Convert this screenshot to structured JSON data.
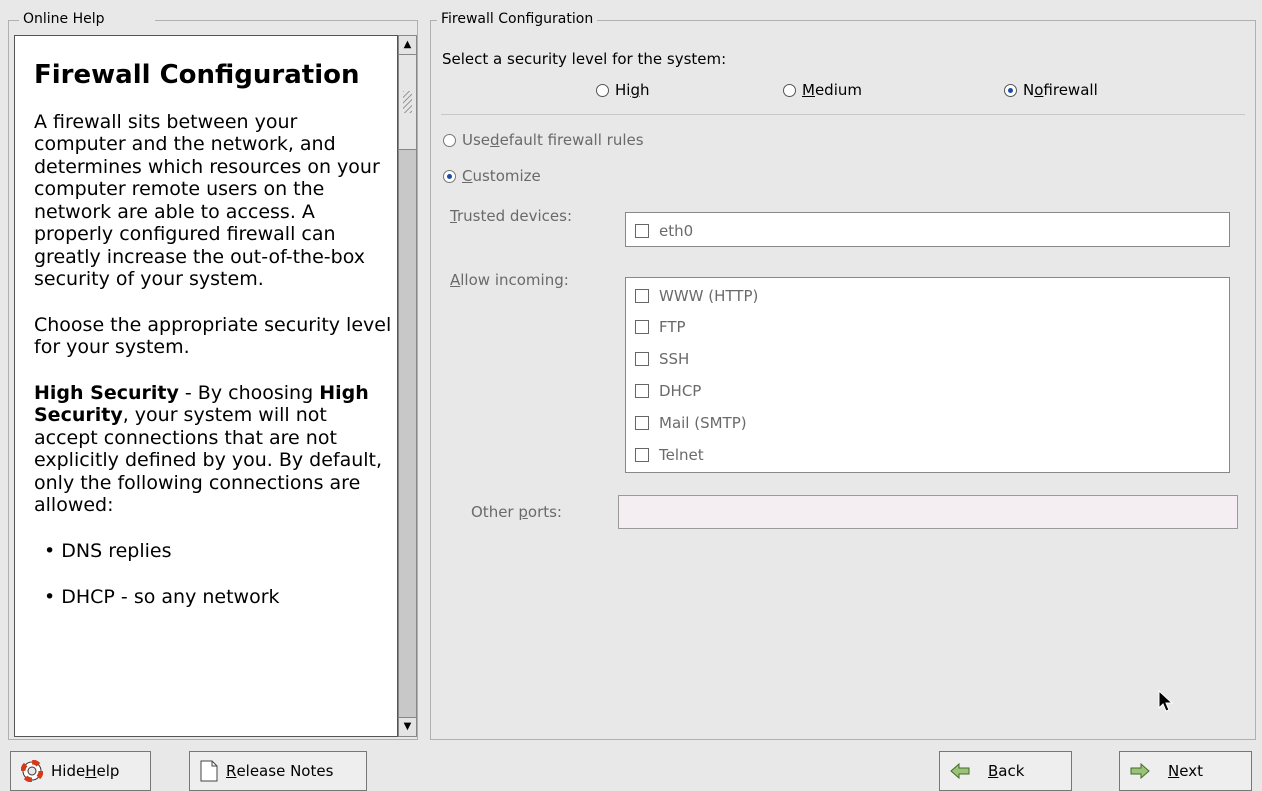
{
  "help": {
    "frame_label": "Online Help",
    "title": "Firewall Configuration",
    "p1": "A firewall sits between your computer and the network, and determines which resources on your computer remote users on the network are able to access. A properly configured firewall can greatly increase the out-of-the-box security of your system.",
    "p2": "Choose the appropriate security level for your system.",
    "p3_b1": "High Security",
    "p3_t1": " - By choosing ",
    "p3_b2": "High Security",
    "p3_t2": ", your system will not accept connections that are not explicitly defined by you. By default, only the following connections are allowed:",
    "bullet1": "• DNS replies",
    "bullet2": "• DHCP - so any network"
  },
  "firewall": {
    "frame_label": "Firewall Configuration",
    "select_label": "Select a security level for the system:",
    "levels": {
      "high_pre": "Hi",
      "high_u": "g",
      "high_post": "h",
      "medium_u": "M",
      "medium_post": "edium",
      "nofw_pre": "N",
      "nofw_u": "o",
      "nofw_post": " firewall"
    },
    "use_default_pre": "Use ",
    "use_default_u": "d",
    "use_default_post": "efault firewall rules",
    "customize_u": "C",
    "customize_post": "ustomize",
    "trusted_u": "T",
    "trusted_post": "rusted devices:",
    "trusted_devices": [
      "eth0"
    ],
    "allow_u": "A",
    "allow_post": "llow incoming:",
    "services": [
      "WWW (HTTP)",
      "FTP",
      "SSH",
      "DHCP",
      "Mail (SMTP)",
      "Telnet"
    ],
    "other_pre": "Other ",
    "other_u": "p",
    "other_post": "orts:",
    "other_value": ""
  },
  "buttons": {
    "hide_help_pre": "Hide ",
    "hide_help_u": "H",
    "hide_help_post": "elp",
    "release_u": "R",
    "release_post": "elease Notes",
    "back_u": "B",
    "back_post": "ack",
    "next_u": "N",
    "next_post": "ext"
  },
  "colors": {
    "radio_dot": "#1b4da8",
    "arrow_green": "#5a8a3a"
  }
}
